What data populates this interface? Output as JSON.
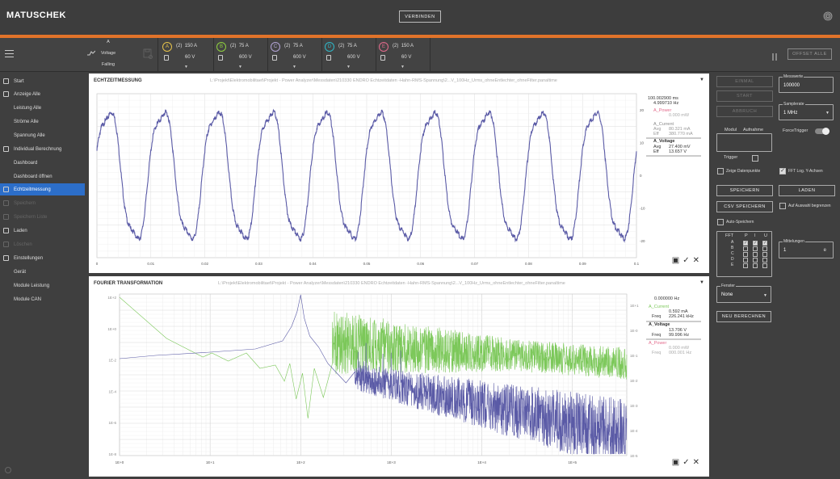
{
  "header": {
    "logo": "MATUSCHEK",
    "connect_label": "VERBINDEN"
  },
  "toolbar": {
    "trigger": {
      "channel": "A",
      "signal": "Voltage",
      "edge": "Falling"
    },
    "channels": [
      {
        "id": "A",
        "mode": "(2)",
        "current": "150 A",
        "voltage": "60 V",
        "color": "#e6c34a"
      },
      {
        "id": "B",
        "mode": "(2)",
        "current": "75 A",
        "voltage": "600 V",
        "color": "#8fcf3f"
      },
      {
        "id": "C",
        "mode": "(2)",
        "current": "75 A",
        "voltage": "600 V",
        "color": "#b3a4d6"
      },
      {
        "id": "D",
        "mode": "(2)",
        "current": "75 A",
        "voltage": "600 V",
        "color": "#2fb8c8"
      },
      {
        "id": "E",
        "mode": "(2)",
        "current": "150 A",
        "voltage": "60 V",
        "color": "#e36b8c"
      }
    ],
    "offset_label": "OFFSET ALLE"
  },
  "sidebar": {
    "items": [
      {
        "label": "Start",
        "level": "top",
        "icon": "home-icon",
        "state": "normal"
      },
      {
        "label": "Anzeige Alle",
        "level": "top",
        "icon": "bar-chart-icon",
        "state": "normal"
      },
      {
        "label": "Leistung Alle",
        "level": "sub",
        "icon": "",
        "state": "normal"
      },
      {
        "label": "Ströme Alle",
        "level": "sub",
        "icon": "",
        "state": "normal"
      },
      {
        "label": "Spannung Alle",
        "level": "sub",
        "icon": "",
        "state": "normal"
      },
      {
        "label": "Individual Berechnung",
        "level": "top",
        "icon": "calc-icon",
        "state": "normal"
      },
      {
        "label": "Dashboard",
        "level": "sub",
        "icon": "",
        "state": "normal"
      },
      {
        "label": "Dashboard öffnen",
        "level": "sub",
        "icon": "",
        "state": "normal"
      },
      {
        "label": "Echtzeitmessung",
        "level": "top",
        "icon": "wave-icon",
        "state": "active"
      },
      {
        "label": "Speichern",
        "level": "top",
        "icon": "save-icon",
        "state": "dim"
      },
      {
        "label": "Speichern Liste",
        "level": "top",
        "icon": "list-icon",
        "state": "dim"
      },
      {
        "label": "Laden",
        "level": "top",
        "icon": "upload-icon",
        "state": "normal"
      },
      {
        "label": "Löschen",
        "level": "top",
        "icon": "delete-icon",
        "state": "dim"
      },
      {
        "label": "Einstellungen",
        "level": "top",
        "icon": "gear-icon",
        "state": "normal"
      },
      {
        "label": "Gerät",
        "level": "sub",
        "icon": "",
        "state": "normal"
      },
      {
        "label": "Module Leistung",
        "level": "sub",
        "icon": "",
        "state": "normal"
      },
      {
        "label": "Module CAN",
        "level": "sub",
        "icon": "",
        "state": "normal"
      }
    ]
  },
  "panels": {
    "time": {
      "title": "ECHTZEITMESSUNG",
      "path": "L:\\Projekt\\Elektromobilitaet\\Projekt - Power Analyzer\\Messdaten\\210330 ENDRO Echtzeitdaten -Hahn-RMS-Spannung\\2...V_100Hz_Urms_ohneEntlechter_ohneFilter.panaltime",
      "legend": {
        "readout_1": "100.002900 ms",
        "readout_2": "4.999710 Hz",
        "power_name": "A_Power",
        "power_val": "0.000 mW",
        "current_name": "A_Current",
        "current_avg_lbl": "Avg",
        "current_avg": "80.321 mA",
        "current_eff_lbl": "Eff",
        "current_eff": "380.770 mA",
        "voltage_name": "A_Voltage",
        "voltage_avg_lbl": "Avg",
        "voltage_avg": "27.400 mV",
        "voltage_eff_lbl": "Eff",
        "voltage_eff": "13.657 V"
      }
    },
    "fft": {
      "title": "FOURIER TRANSFORMATION",
      "path": "L:\\Projekt\\Elektromobilitaet\\Projekt - Power Analyzer\\Messdaten\\210330 ENDRO Echtzeitdaten -Hahn-RMS-Spannung\\2...V_100Hz_Urms_ohneEntlechter_ohneFilter.panaltime",
      "legend": {
        "readout": "0.000000 Hz",
        "current_name": "A_Current",
        "current_val": "0.592 mA",
        "current_freq_lbl": "Freq",
        "current_freq": "226.241 kHz",
        "voltage_name": "A_Voltage",
        "voltage_val": "13.706 V",
        "voltage_freq_lbl": "Freq",
        "voltage_freq": "99.996 Hz",
        "power_name": "A_Power",
        "power_val": "0.000 mW",
        "power_freq_lbl": "Freq",
        "power_freq": "000.001 Hz"
      }
    }
  },
  "chart_data": [
    {
      "type": "line",
      "title": "ECHTZEITMESSUNG",
      "x_ticks": [
        "0",
        "0.01",
        "0.02",
        "0.03",
        "0.04",
        "0.05",
        "0.06",
        "0.07",
        "0.08",
        "0.09",
        "0.1"
      ],
      "y_ticks_right": [
        "20",
        "10",
        "0",
        "-10",
        "-20"
      ],
      "xlim": [
        0,
        0.1
      ],
      "ylim": [
        -25,
        25
      ],
      "series": [
        {
          "name": "A_Voltage",
          "color": "#5a5aa6",
          "frequency_hz": 100,
          "amplitude": 22
        }
      ]
    },
    {
      "type": "line",
      "title": "FOURIER TRANSFORMATION",
      "x_ticks": [
        "1E+0",
        "1E+1",
        "1E+2",
        "1E+3",
        "1E+4",
        "1E+5"
      ],
      "y_ticks_left": [
        "1E+2",
        "1E+0",
        "1E-2",
        "1E-4",
        "1E-6",
        "1E-8"
      ],
      "y_ticks_right": [
        "1E+1",
        "1E-0",
        "1E-1",
        "1E-2",
        "1E-3",
        "1E-4",
        "1E-5"
      ],
      "x_scale": "log",
      "y_scale": "log",
      "series": [
        {
          "name": "A_Current",
          "color": "#7cc85a"
        },
        {
          "name": "A_Voltage",
          "color": "#5a5aa6",
          "peak_hz": 100
        }
      ]
    }
  ],
  "right_panel": {
    "einmal": "EINMAL",
    "start": "START",
    "abbruch": "ABBRUCH",
    "messwerte_label": "Messwerte",
    "messwerte_value": "100000",
    "samplerate_label": "Samplerate",
    "samplerate_value": "1 MHz",
    "force_trigger": "ForceTrigger",
    "modul_label": "Modul",
    "aufnahme_label": "Aufnahme",
    "trigger_label": "Trigger",
    "show_points": "Zeige Datenpunkte",
    "fft_log": "FFT Log. Y-Achsen",
    "speichern": "SPEICHERN",
    "laden": "LADEN",
    "csv": "CSV SPEICHERN",
    "auf_auswahl": "Auf Auswahl begrenzen",
    "auto_save": "Auto-Speichern",
    "fft_label": "FFT",
    "p_label": "P",
    "i_label": "I",
    "u_label": "U",
    "rows": [
      "A",
      "B",
      "C",
      "D",
      "E"
    ],
    "mittelungen_label": "Mittelungen",
    "mittelungen_value": "1",
    "mittelungen_unit": "e",
    "fenster_label": "Fenster",
    "fenster_value": "None",
    "neu_berechnen": "NEU BERECHNEN"
  }
}
